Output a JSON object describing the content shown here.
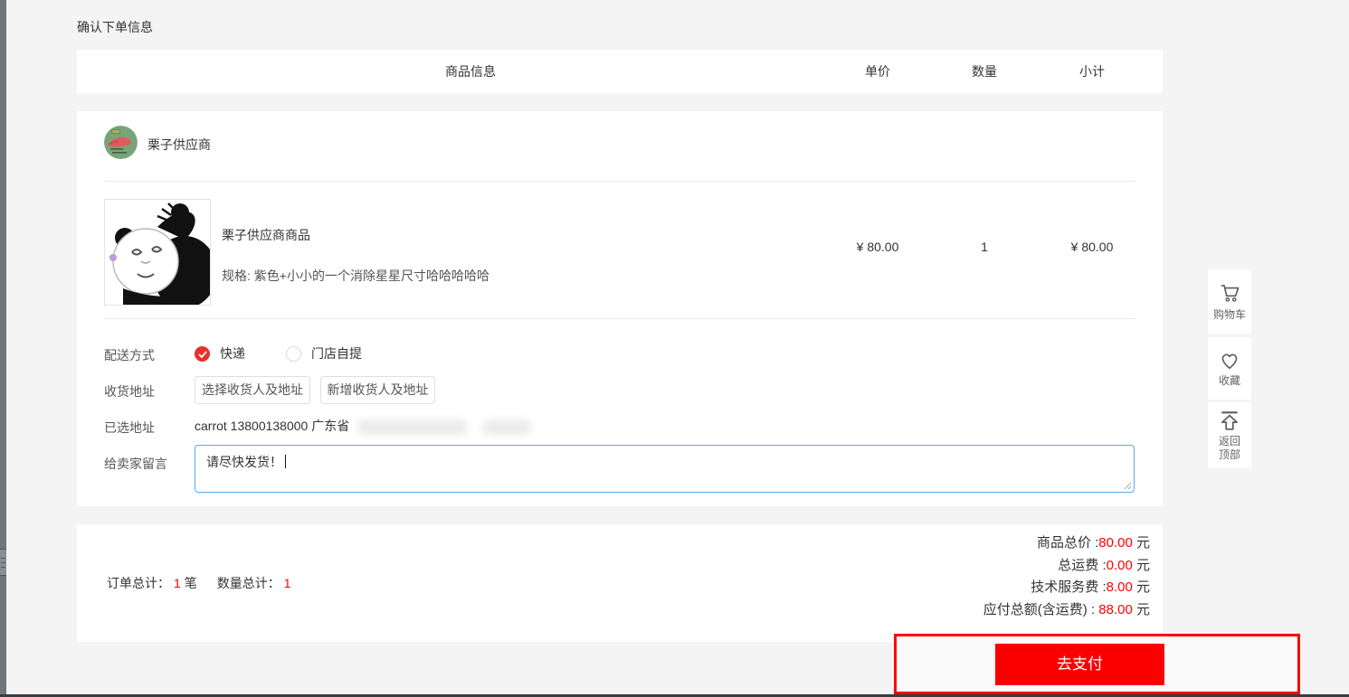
{
  "page": {
    "title": "确认下单信息"
  },
  "table": {
    "headers": {
      "product": "商品信息",
      "unit_price": "单价",
      "quantity": "数量",
      "subtotal": "小计"
    }
  },
  "store": {
    "name": "栗子供应商"
  },
  "product": {
    "name": "栗子供应商商品",
    "spec": "规格: 紫色+小小的一个消除星星尺寸哈哈哈哈哈",
    "unit_price": "¥ 80.00",
    "quantity": "1",
    "subtotal": "¥ 80.00"
  },
  "form": {
    "delivery_label": "配送方式",
    "delivery_options": [
      {
        "label": "快递",
        "selected": true
      },
      {
        "label": "门店自提",
        "selected": false
      }
    ],
    "address_label": "收货地址",
    "select_address_button": "选择收货人及地址",
    "add_address_button": "新增收货人及地址",
    "selected_address_label": "已选地址",
    "selected_address_value": "carrot 13800138000 广东省",
    "message_label": "给卖家留言",
    "message_value": "请尽快发货！"
  },
  "summary": {
    "order_total_label": "订单总计：",
    "order_total_value": "1",
    "order_total_unit": "笔",
    "quantity_total_label": "数量总计：",
    "quantity_total_value": "1",
    "lines": [
      {
        "label": "商品总价 :",
        "value": "80.00",
        "unit": " 元"
      },
      {
        "label": "总运费 :",
        "value": "0.00",
        "unit": " 元"
      },
      {
        "label": "技术服务费 :",
        "value": "8.00",
        "unit": " 元"
      },
      {
        "label": "应付总额(含运费) : ",
        "value": "88.00",
        "unit": " 元"
      }
    ]
  },
  "pay": {
    "button_label": "去支付"
  },
  "float_bar": {
    "cart_label": "购物车",
    "favorites_label": "收藏",
    "back_to_top_label": "返回顶部"
  },
  "colors": {
    "accent_red": "#ff0000",
    "pay_button_red": "#fb0000",
    "radio_red": "#e8302c",
    "textarea_focus_blue": "#5ea7f0",
    "page_background": "#f4f4f5"
  }
}
